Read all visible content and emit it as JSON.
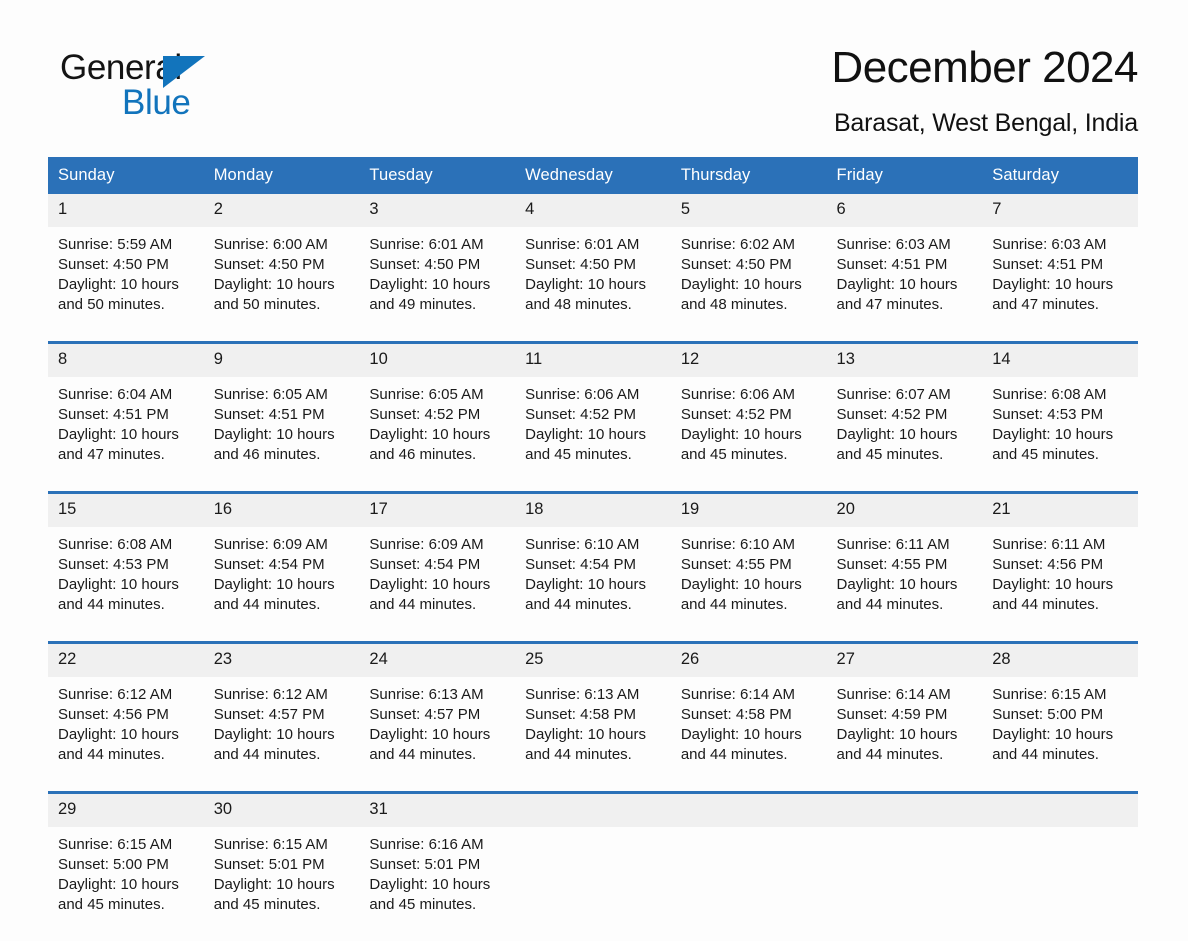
{
  "brand": {
    "name_part1": "General",
    "name_part2": "Blue",
    "triangle_color": "#1274bc"
  },
  "header": {
    "title": "December 2024",
    "subtitle": "Barasat, West Bengal, India"
  },
  "theme": {
    "header_blue": "#2b71b8",
    "date_band_gray": "#f0f0f0",
    "page_background": "#fdfdfd",
    "text_color": "#1a1a1a"
  },
  "weekdays": [
    "Sunday",
    "Monday",
    "Tuesday",
    "Wednesday",
    "Thursday",
    "Friday",
    "Saturday"
  ],
  "labels": {
    "sunrise_prefix": "Sunrise:",
    "sunset_prefix": "Sunset:",
    "daylight_prefix": "Daylight:"
  },
  "weeks": [
    {
      "days": [
        {
          "date": "1",
          "sunrise": "Sunrise: 5:59 AM",
          "sunset": "Sunset: 4:50 PM",
          "daylight_line1": "Daylight: 10 hours",
          "daylight_line2": "and 50 minutes."
        },
        {
          "date": "2",
          "sunrise": "Sunrise: 6:00 AM",
          "sunset": "Sunset: 4:50 PM",
          "daylight_line1": "Daylight: 10 hours",
          "daylight_line2": "and 50 minutes."
        },
        {
          "date": "3",
          "sunrise": "Sunrise: 6:01 AM",
          "sunset": "Sunset: 4:50 PM",
          "daylight_line1": "Daylight: 10 hours",
          "daylight_line2": "and 49 minutes."
        },
        {
          "date": "4",
          "sunrise": "Sunrise: 6:01 AM",
          "sunset": "Sunset: 4:50 PM",
          "daylight_line1": "Daylight: 10 hours",
          "daylight_line2": "and 48 minutes."
        },
        {
          "date": "5",
          "sunrise": "Sunrise: 6:02 AM",
          "sunset": "Sunset: 4:50 PM",
          "daylight_line1": "Daylight: 10 hours",
          "daylight_line2": "and 48 minutes."
        },
        {
          "date": "6",
          "sunrise": "Sunrise: 6:03 AM",
          "sunset": "Sunset: 4:51 PM",
          "daylight_line1": "Daylight: 10 hours",
          "daylight_line2": "and 47 minutes."
        },
        {
          "date": "7",
          "sunrise": "Sunrise: 6:03 AM",
          "sunset": "Sunset: 4:51 PM",
          "daylight_line1": "Daylight: 10 hours",
          "daylight_line2": "and 47 minutes."
        }
      ]
    },
    {
      "days": [
        {
          "date": "8",
          "sunrise": "Sunrise: 6:04 AM",
          "sunset": "Sunset: 4:51 PM",
          "daylight_line1": "Daylight: 10 hours",
          "daylight_line2": "and 47 minutes."
        },
        {
          "date": "9",
          "sunrise": "Sunrise: 6:05 AM",
          "sunset": "Sunset: 4:51 PM",
          "daylight_line1": "Daylight: 10 hours",
          "daylight_line2": "and 46 minutes."
        },
        {
          "date": "10",
          "sunrise": "Sunrise: 6:05 AM",
          "sunset": "Sunset: 4:52 PM",
          "daylight_line1": "Daylight: 10 hours",
          "daylight_line2": "and 46 minutes."
        },
        {
          "date": "11",
          "sunrise": "Sunrise: 6:06 AM",
          "sunset": "Sunset: 4:52 PM",
          "daylight_line1": "Daylight: 10 hours",
          "daylight_line2": "and 45 minutes."
        },
        {
          "date": "12",
          "sunrise": "Sunrise: 6:06 AM",
          "sunset": "Sunset: 4:52 PM",
          "daylight_line1": "Daylight: 10 hours",
          "daylight_line2": "and 45 minutes."
        },
        {
          "date": "13",
          "sunrise": "Sunrise: 6:07 AM",
          "sunset": "Sunset: 4:52 PM",
          "daylight_line1": "Daylight: 10 hours",
          "daylight_line2": "and 45 minutes."
        },
        {
          "date": "14",
          "sunrise": "Sunrise: 6:08 AM",
          "sunset": "Sunset: 4:53 PM",
          "daylight_line1": "Daylight: 10 hours",
          "daylight_line2": "and 45 minutes."
        }
      ]
    },
    {
      "days": [
        {
          "date": "15",
          "sunrise": "Sunrise: 6:08 AM",
          "sunset": "Sunset: 4:53 PM",
          "daylight_line1": "Daylight: 10 hours",
          "daylight_line2": "and 44 minutes."
        },
        {
          "date": "16",
          "sunrise": "Sunrise: 6:09 AM",
          "sunset": "Sunset: 4:54 PM",
          "daylight_line1": "Daylight: 10 hours",
          "daylight_line2": "and 44 minutes."
        },
        {
          "date": "17",
          "sunrise": "Sunrise: 6:09 AM",
          "sunset": "Sunset: 4:54 PM",
          "daylight_line1": "Daylight: 10 hours",
          "daylight_line2": "and 44 minutes."
        },
        {
          "date": "18",
          "sunrise": "Sunrise: 6:10 AM",
          "sunset": "Sunset: 4:54 PM",
          "daylight_line1": "Daylight: 10 hours",
          "daylight_line2": "and 44 minutes."
        },
        {
          "date": "19",
          "sunrise": "Sunrise: 6:10 AM",
          "sunset": "Sunset: 4:55 PM",
          "daylight_line1": "Daylight: 10 hours",
          "daylight_line2": "and 44 minutes."
        },
        {
          "date": "20",
          "sunrise": "Sunrise: 6:11 AM",
          "sunset": "Sunset: 4:55 PM",
          "daylight_line1": "Daylight: 10 hours",
          "daylight_line2": "and 44 minutes."
        },
        {
          "date": "21",
          "sunrise": "Sunrise: 6:11 AM",
          "sunset": "Sunset: 4:56 PM",
          "daylight_line1": "Daylight: 10 hours",
          "daylight_line2": "and 44 minutes."
        }
      ]
    },
    {
      "days": [
        {
          "date": "22",
          "sunrise": "Sunrise: 6:12 AM",
          "sunset": "Sunset: 4:56 PM",
          "daylight_line1": "Daylight: 10 hours",
          "daylight_line2": "and 44 minutes."
        },
        {
          "date": "23",
          "sunrise": "Sunrise: 6:12 AM",
          "sunset": "Sunset: 4:57 PM",
          "daylight_line1": "Daylight: 10 hours",
          "daylight_line2": "and 44 minutes."
        },
        {
          "date": "24",
          "sunrise": "Sunrise: 6:13 AM",
          "sunset": "Sunset: 4:57 PM",
          "daylight_line1": "Daylight: 10 hours",
          "daylight_line2": "and 44 minutes."
        },
        {
          "date": "25",
          "sunrise": "Sunrise: 6:13 AM",
          "sunset": "Sunset: 4:58 PM",
          "daylight_line1": "Daylight: 10 hours",
          "daylight_line2": "and 44 minutes."
        },
        {
          "date": "26",
          "sunrise": "Sunrise: 6:14 AM",
          "sunset": "Sunset: 4:58 PM",
          "daylight_line1": "Daylight: 10 hours",
          "daylight_line2": "and 44 minutes."
        },
        {
          "date": "27",
          "sunrise": "Sunrise: 6:14 AM",
          "sunset": "Sunset: 4:59 PM",
          "daylight_line1": "Daylight: 10 hours",
          "daylight_line2": "and 44 minutes."
        },
        {
          "date": "28",
          "sunrise": "Sunrise: 6:15 AM",
          "sunset": "Sunset: 5:00 PM",
          "daylight_line1": "Daylight: 10 hours",
          "daylight_line2": "and 44 minutes."
        }
      ]
    },
    {
      "days": [
        {
          "date": "29",
          "sunrise": "Sunrise: 6:15 AM",
          "sunset": "Sunset: 5:00 PM",
          "daylight_line1": "Daylight: 10 hours",
          "daylight_line2": "and 45 minutes."
        },
        {
          "date": "30",
          "sunrise": "Sunrise: 6:15 AM",
          "sunset": "Sunset: 5:01 PM",
          "daylight_line1": "Daylight: 10 hours",
          "daylight_line2": "and 45 minutes."
        },
        {
          "date": "31",
          "sunrise": "Sunrise: 6:16 AM",
          "sunset": "Sunset: 5:01 PM",
          "daylight_line1": "Daylight: 10 hours",
          "daylight_line2": "and 45 minutes."
        },
        {
          "date": "",
          "sunrise": "",
          "sunset": "",
          "daylight_line1": "",
          "daylight_line2": ""
        },
        {
          "date": "",
          "sunrise": "",
          "sunset": "",
          "daylight_line1": "",
          "daylight_line2": ""
        },
        {
          "date": "",
          "sunrise": "",
          "sunset": "",
          "daylight_line1": "",
          "daylight_line2": ""
        },
        {
          "date": "",
          "sunrise": "",
          "sunset": "",
          "daylight_line1": "",
          "daylight_line2": ""
        }
      ]
    }
  ]
}
